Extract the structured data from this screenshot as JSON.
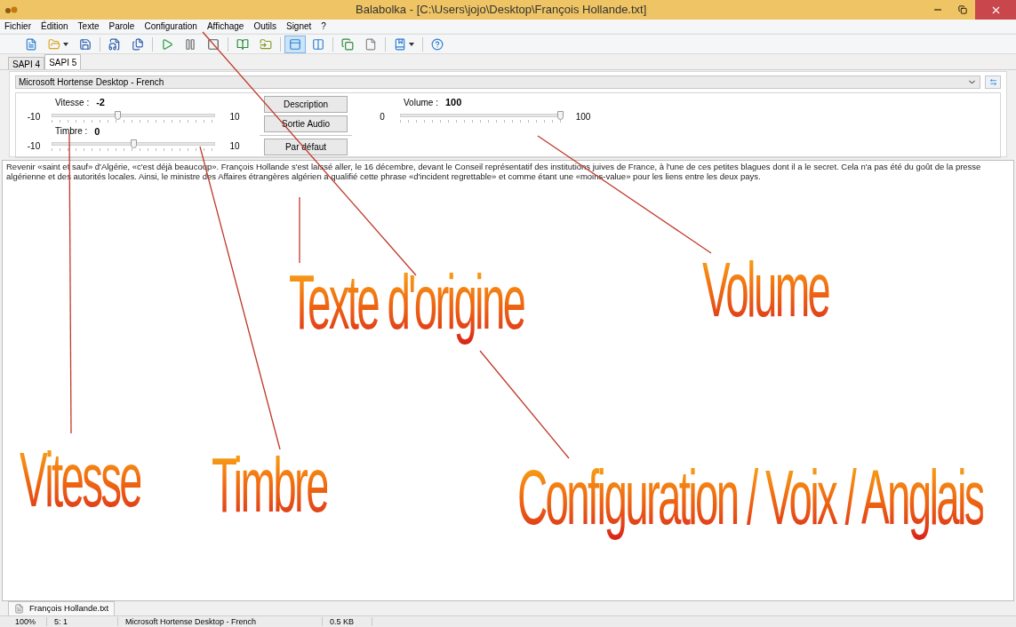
{
  "window": {
    "title": "Balabolka - [C:\\Users\\jojo\\Desktop\\François Hollande.txt]"
  },
  "menu": [
    "Fichier",
    "Édition",
    "Texte",
    "Parole",
    "Configuration",
    "Affichage",
    "Outils",
    "Signet",
    "?"
  ],
  "toolbar": [
    {
      "pressed": false,
      "dropdown": false
    },
    {
      "pressed": false,
      "dropdown": true
    },
    {
      "pressed": false,
      "dropdown": false
    },
    {
      "pressed": false,
      "dropdown": false
    },
    {
      "pressed": false,
      "dropdown": false
    },
    {
      "pressed": false,
      "dropdown": false
    },
    {
      "pressed": false,
      "dropdown": false
    },
    {
      "pressed": false,
      "dropdown": false
    },
    {
      "pressed": false,
      "dropdown": false
    },
    {
      "pressed": false,
      "dropdown": false
    },
    {
      "pressed": true,
      "dropdown": false
    },
    {
      "pressed": false,
      "dropdown": false
    },
    {
      "pressed": false,
      "dropdown": false
    },
    {
      "pressed": false,
      "dropdown": false
    },
    {
      "pressed": false,
      "dropdown": true
    },
    {
      "pressed": false,
      "dropdown": false
    }
  ],
  "engine_tabs": [
    {
      "label": "SAPI 4",
      "selected": false
    },
    {
      "label": "SAPI 5",
      "selected": true
    }
  ],
  "voice": {
    "value": "Microsoft Hortense Desktop - French"
  },
  "sliders": [
    {
      "label": "Vitesse :",
      "value": "-2",
      "min": "-10",
      "max": "10",
      "level": 0.4
    },
    {
      "label": "Timbre :",
      "value": "0",
      "min": "-10",
      "max": "10",
      "level": 0.5
    },
    {
      "label": "Volume :",
      "value": "100",
      "min": "0",
      "max": "100",
      "level": 1
    }
  ],
  "buttons": [
    "Description",
    "Sortie Audio",
    "Par défaut"
  ],
  "text": "Revenir «saint et sauf» d'Algérie, «c'est déjà beaucoup». François Hollande s'est laissé aller, le 16 décembre, devant le Conseil représentatif des institutions juives de France, à l'une de ces petites blagues dont il a le secret. Cela n'a pas été du goût de la presse algérienne et des autorités locales. Ainsi, le ministre des Affaires étrangères algérien a qualifié cette phrase «d'incident regrettable» et comme étant une «moins-value» pour les liens entre les deux pays.",
  "document_tabs": [
    {
      "label": "François Hollande.txt",
      "selected": true
    }
  ],
  "status_bar": [
    "100%",
    "5:  1",
    "Microsoft Hortense Desktop - French",
    "0.5 KB"
  ],
  "annotations": [
    "Texte d'origine",
    "Volume",
    "Vitesse",
    "Timbre",
    "Configuration / Voix / Anglais"
  ]
}
